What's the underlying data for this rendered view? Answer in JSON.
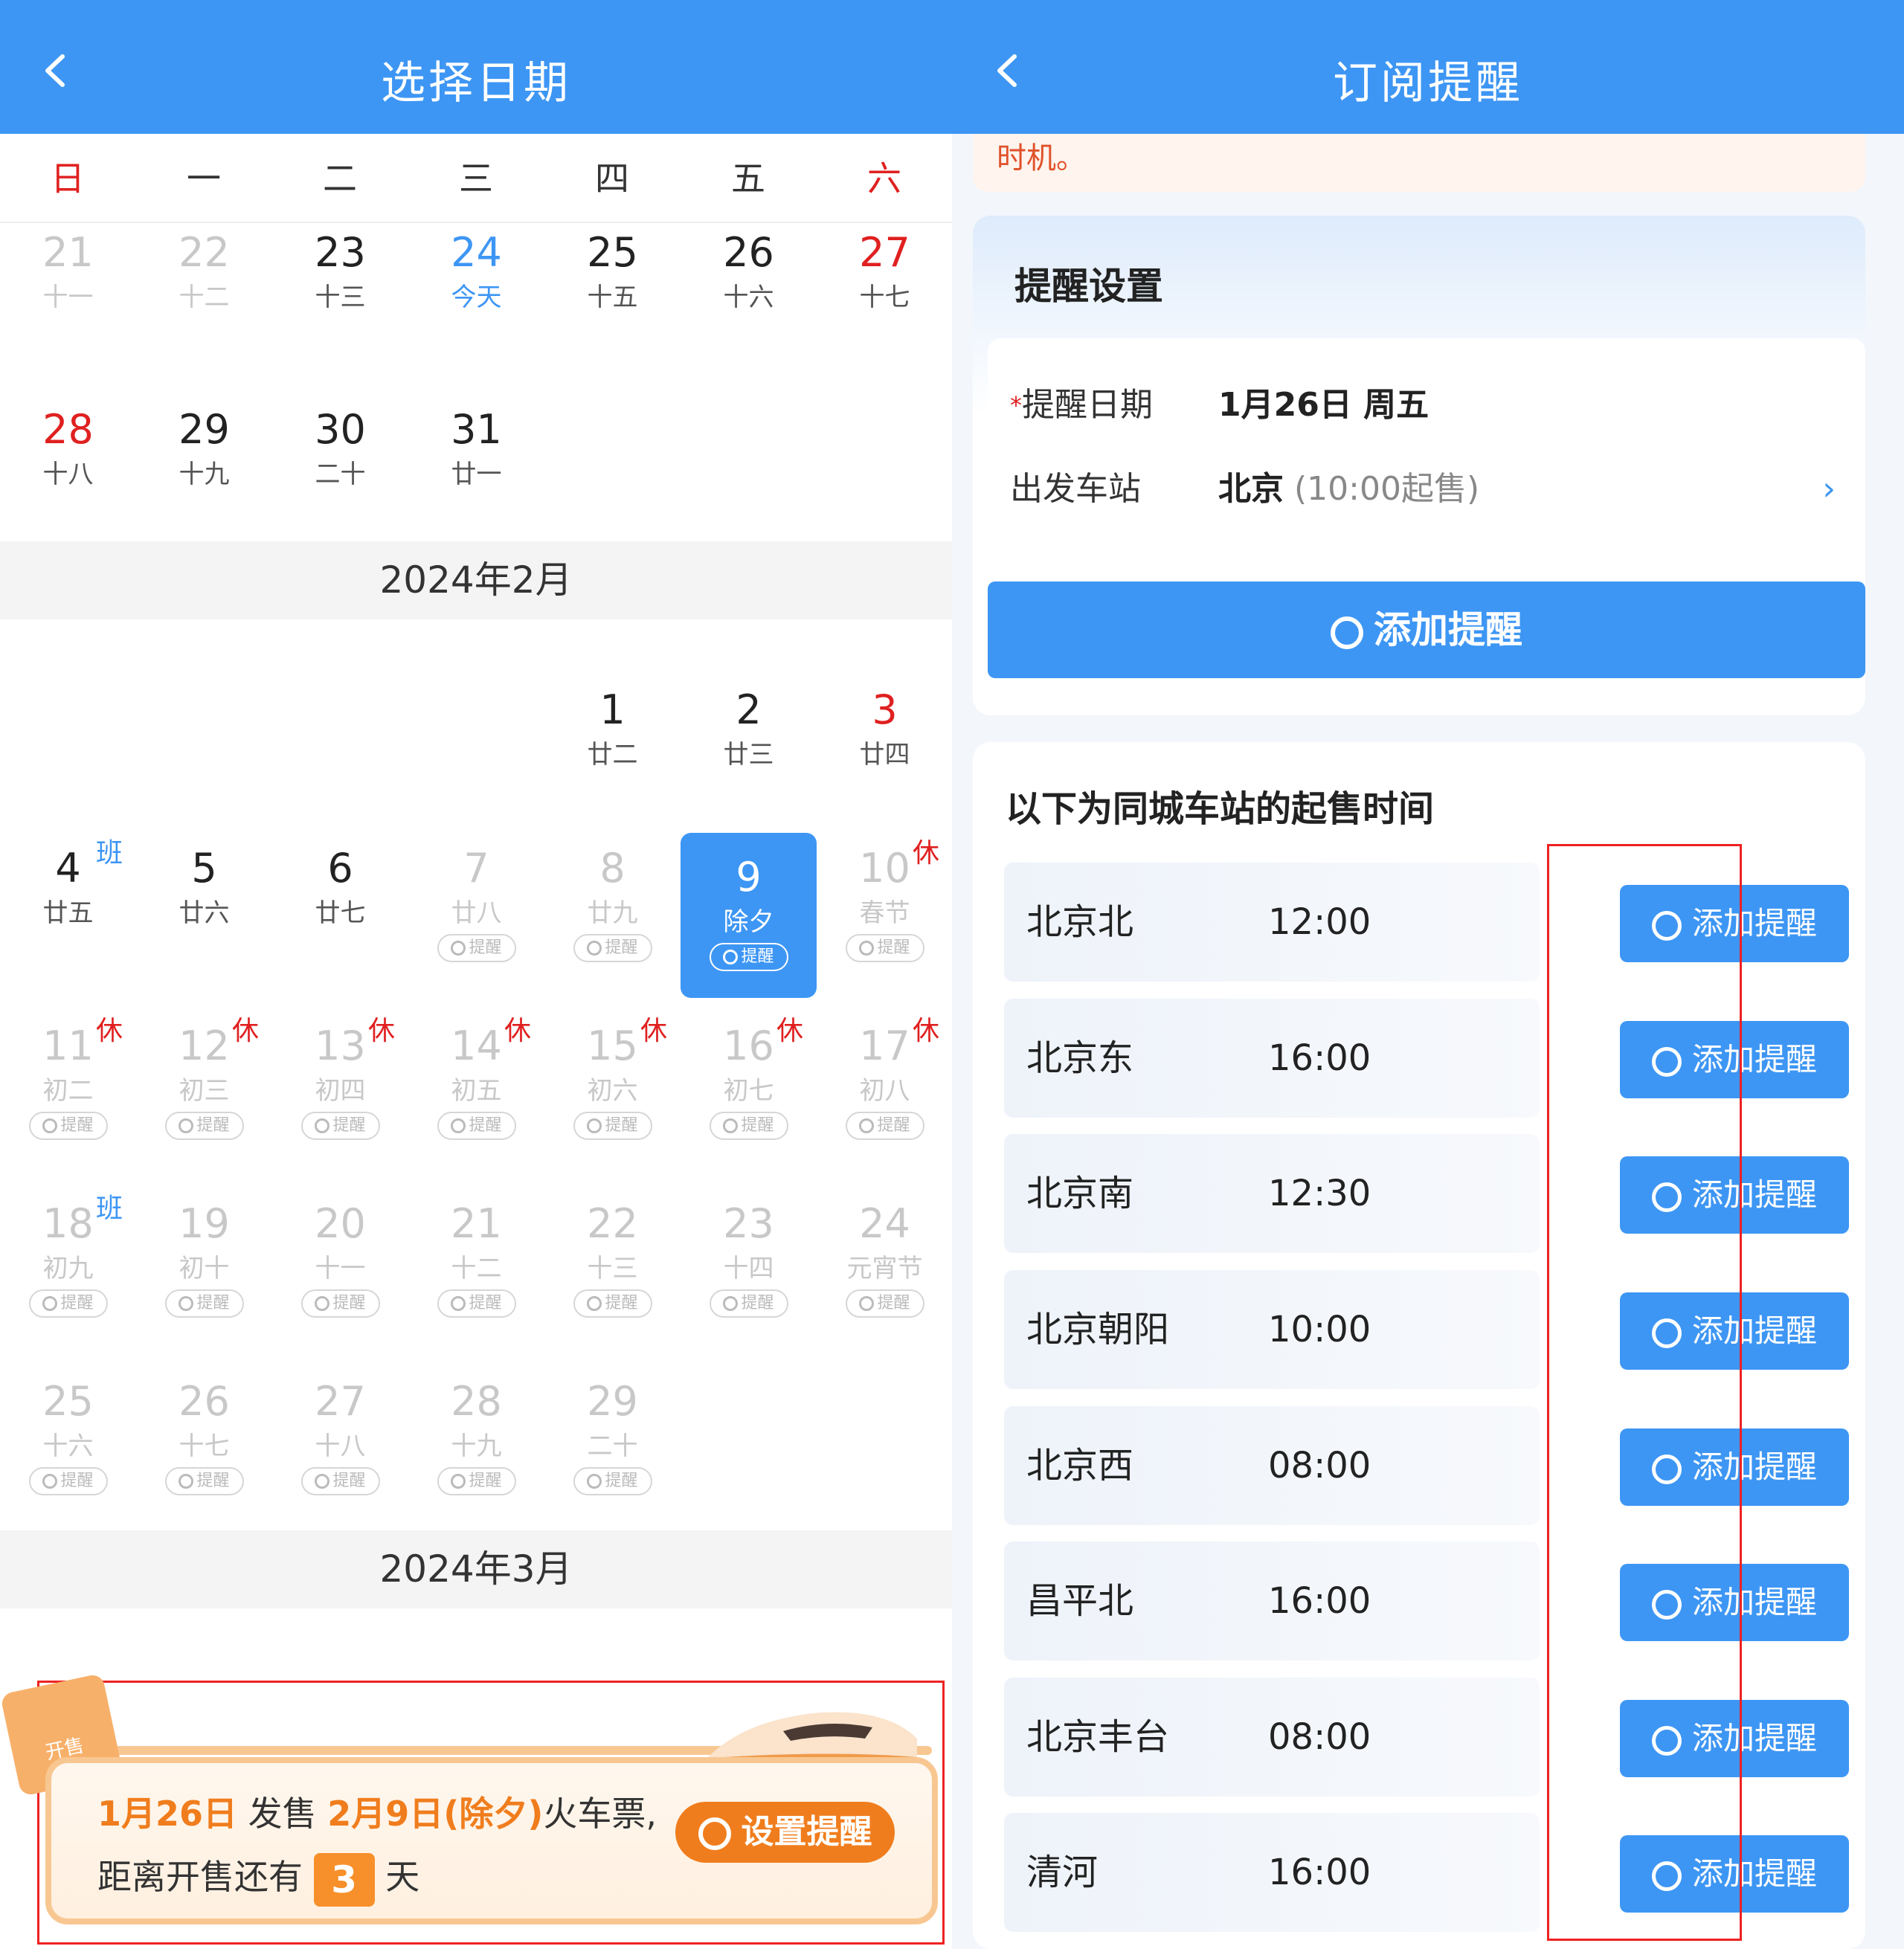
{
  "left": {
    "title": "选择日期",
    "weekdays": [
      "日",
      "一",
      "二",
      "三",
      "四",
      "五",
      "六"
    ],
    "jan_row1": [
      {
        "d": "21",
        "l": "十一"
      },
      {
        "d": "22",
        "l": "十二"
      },
      {
        "d": "23",
        "l": "十三"
      },
      {
        "d": "24",
        "l": "今天"
      },
      {
        "d": "25",
        "l": "十五"
      },
      {
        "d": "26",
        "l": "十六"
      },
      {
        "d": "27",
        "l": "十七"
      }
    ],
    "jan_row2": [
      {
        "d": "28",
        "l": "十八"
      },
      {
        "d": "29",
        "l": "十九"
      },
      {
        "d": "30",
        "l": "二十"
      },
      {
        "d": "31",
        "l": "廿一"
      }
    ],
    "feb_title": "2024年2月",
    "feb_row1": [
      {
        "d": "1",
        "l": "廿二"
      },
      {
        "d": "2",
        "l": "廿三"
      },
      {
        "d": "3",
        "l": "廿四"
      }
    ],
    "feb_row2": [
      {
        "d": "4",
        "l": "廿五",
        "tag": "班"
      },
      {
        "d": "5",
        "l": "廿六"
      },
      {
        "d": "6",
        "l": "廿七"
      },
      {
        "d": "7",
        "l": "廿八"
      },
      {
        "d": "8",
        "l": "廿九"
      },
      {
        "d": "9",
        "l": "除夕"
      },
      {
        "d": "10",
        "l": "春节",
        "tag": "休"
      }
    ],
    "feb_row3": [
      {
        "d": "11",
        "l": "初二",
        "tag": "休"
      },
      {
        "d": "12",
        "l": "初三",
        "tag": "休"
      },
      {
        "d": "13",
        "l": "初四",
        "tag": "休"
      },
      {
        "d": "14",
        "l": "初五",
        "tag": "休"
      },
      {
        "d": "15",
        "l": "初六",
        "tag": "休"
      },
      {
        "d": "16",
        "l": "初七",
        "tag": "休"
      },
      {
        "d": "17",
        "l": "初八",
        "tag": "休"
      }
    ],
    "feb_row4": [
      {
        "d": "18",
        "l": "初九",
        "tag": "班"
      },
      {
        "d": "19",
        "l": "初十"
      },
      {
        "d": "20",
        "l": "十一"
      },
      {
        "d": "21",
        "l": "十二"
      },
      {
        "d": "22",
        "l": "十三"
      },
      {
        "d": "23",
        "l": "十四"
      },
      {
        "d": "24",
        "l": "元宵节"
      }
    ],
    "feb_row5": [
      {
        "d": "25",
        "l": "十六"
      },
      {
        "d": "26",
        "l": "十七"
      },
      {
        "d": "27",
        "l": "十八"
      },
      {
        "d": "28",
        "l": "十九"
      },
      {
        "d": "29",
        "l": "二十"
      }
    ],
    "remind_label": "提醒",
    "mar_title": "2024年3月",
    "banner": {
      "date1": "1月26日",
      "sell": "发售",
      "date2": "2月9日(除夕)",
      "suffix": "火车票,",
      "line2_prefix": "距离开售还有",
      "count": "3",
      "line2_suffix": "天",
      "button": "设置提醒",
      "icon_text": "开售"
    }
  },
  "right": {
    "title": "订阅提醒",
    "tip_text": "时机。",
    "settings_title": "提醒设置",
    "date_label": "提醒日期",
    "date_value": "1月26日 周五",
    "station_label": "出发车站",
    "station_value": "北京",
    "station_hint": "(10:00起售)",
    "add_button": "添加提醒",
    "list_title": "以下为同城车站的起售时间",
    "stations": [
      {
        "name": "北京北",
        "time": "12:00",
        "btn": "添加提醒"
      },
      {
        "name": "北京东",
        "time": "16:00",
        "btn": "添加提醒"
      },
      {
        "name": "北京南",
        "time": "12:30",
        "btn": "添加提醒"
      },
      {
        "name": "北京朝阳",
        "time": "10:00",
        "btn": "添加提醒"
      },
      {
        "name": "北京西",
        "time": "08:00",
        "btn": "添加提醒"
      },
      {
        "name": "昌平北",
        "time": "16:00",
        "btn": "添加提醒"
      },
      {
        "name": "北京丰台",
        "time": "08:00",
        "btn": "添加提醒"
      },
      {
        "name": "清河",
        "time": "16:00",
        "btn": "添加提醒"
      }
    ]
  }
}
